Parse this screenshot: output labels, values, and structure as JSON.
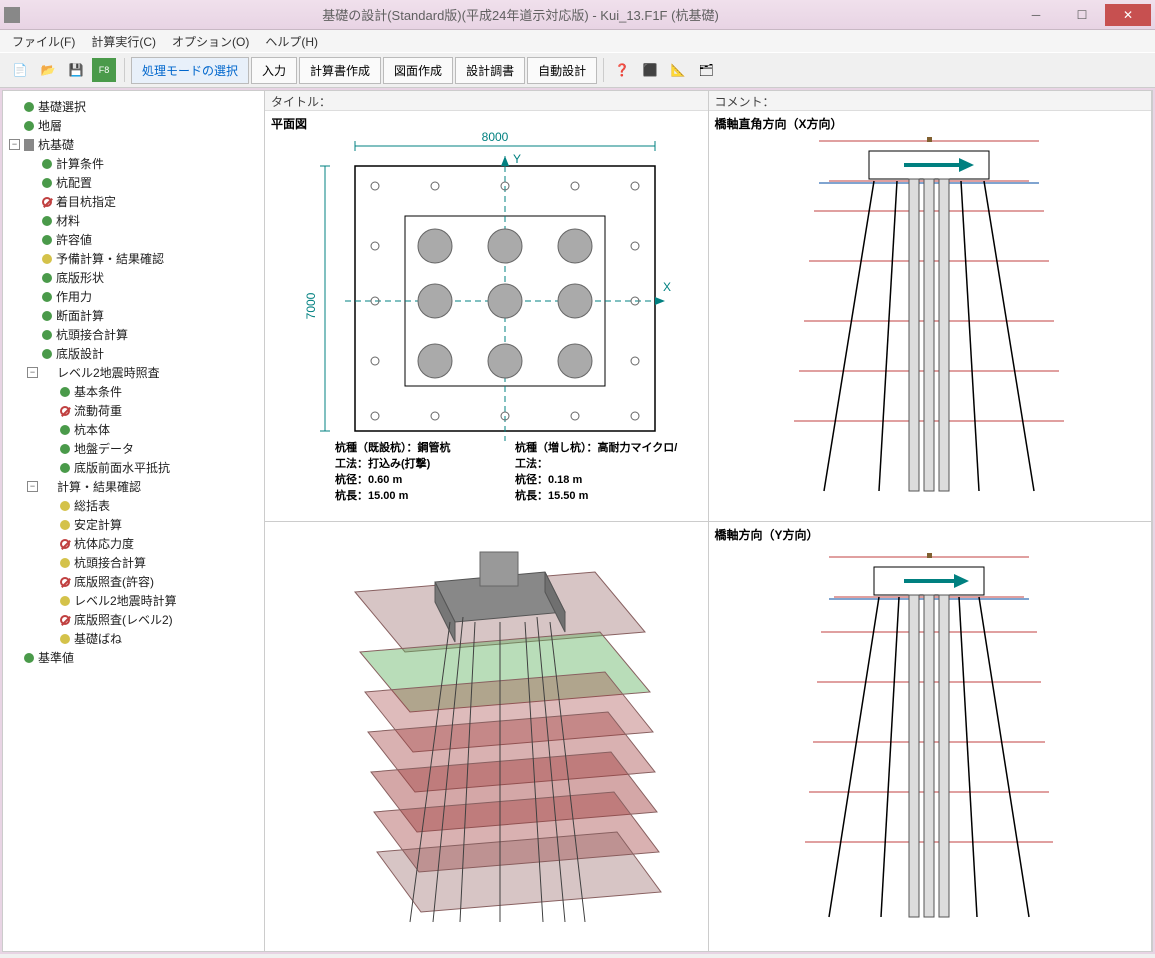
{
  "window": {
    "title": "基礎の設計(Standard版)(平成24年道示対応版) - Kui_13.F1F (杭基礎)"
  },
  "menu": {
    "file": "ファイル(F)",
    "calc": "計算実行(C)",
    "option": "オプション(O)",
    "help": "ヘルプ(H)"
  },
  "toolbar": {
    "mode_select": "処理モードの選択",
    "input": "入力",
    "calc_report": "計算書作成",
    "drawing": "図面作成",
    "design_book": "設計調書",
    "auto_design": "自動設計"
  },
  "tree": {
    "n0": "基礎選択",
    "n1": "地層",
    "n2": "杭基礎",
    "n2_0": "計算条件",
    "n2_1": "杭配置",
    "n2_2": "着目杭指定",
    "n2_3": "材料",
    "n2_4": "許容値",
    "n2_5": "予備計算・結果確認",
    "n2_6": "底版形状",
    "n2_7": "作用力",
    "n2_8": "断面計算",
    "n2_9": "杭頭接合計算",
    "n2_10": "底版設計",
    "n2_11": "レベル2地震時照査",
    "n2_11_0": "基本条件",
    "n2_11_1": "流動荷重",
    "n2_11_2": "杭本体",
    "n2_11_3": "地盤データ",
    "n2_11_4": "底版前面水平抵抗",
    "n2_12": "計算・結果確認",
    "n2_12_0": "総括表",
    "n2_12_1": "安定計算",
    "n2_12_2": "杭体応力度",
    "n2_12_3": "杭頭接合計算",
    "n2_12_4": "底版照査(許容)",
    "n2_12_5": "レベル2地震時計算",
    "n2_12_6": "底版照査(レベル2)",
    "n2_12_7": "基礎ばね",
    "n3": "基準値"
  },
  "headers": {
    "title_label": "タイトル：",
    "comment_label": "コメント："
  },
  "plan": {
    "title": "平面図",
    "width": "8000",
    "height": "7000",
    "info1a": "杭種（既設杭）：鋼管杭",
    "info2a": "工法：打込み(打撃)",
    "info3a": "杭径：0.60 m",
    "info4a": "杭長：15.00 m",
    "info1b": "杭種（増し杭）：高耐力マイクロ/",
    "info2b": "工法：",
    "info3b": "杭径：0.18 m",
    "info4b": "杭長：15.50 m"
  },
  "elev": {
    "x_title": "橋軸直角方向（X方向）",
    "y_title": "橋軸方向（Y方向）"
  }
}
